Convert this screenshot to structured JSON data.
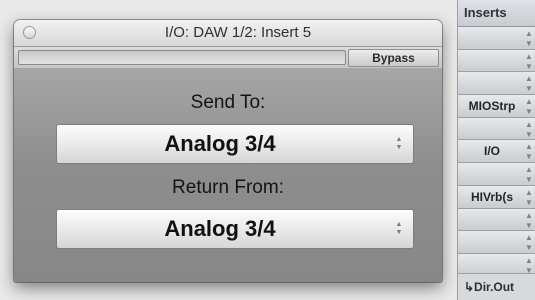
{
  "inserts": {
    "header": "Inserts",
    "slots": [
      {
        "label": ""
      },
      {
        "label": ""
      },
      {
        "label": ""
      },
      {
        "label": "MIOStrp"
      },
      {
        "label": ""
      },
      {
        "label": "I/O"
      },
      {
        "label": ""
      },
      {
        "label": "HIVrb(s"
      },
      {
        "label": ""
      },
      {
        "label": ""
      },
      {
        "label": ""
      }
    ],
    "footer": "↳Dir.Out"
  },
  "window": {
    "title": "I/O: DAW 1/2: Insert 5",
    "bypass_label": "Bypass",
    "send_label": "Send To:",
    "send_value": "Analog 3/4",
    "return_label": "Return From:",
    "return_value": "Analog 3/4"
  },
  "icons": {
    "close": "close-icon",
    "popup_arrows": "up-down-arrows-icon"
  }
}
